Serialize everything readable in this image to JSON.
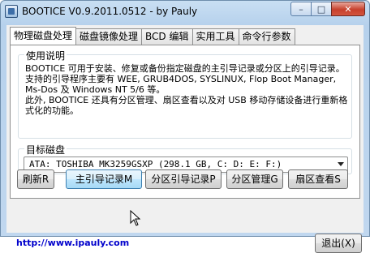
{
  "window": {
    "title": "BOOTICE V0.9.2011.0512 - by Pauly",
    "minimize_glyph": "–",
    "maximize_glyph": "□",
    "close_glyph": "✕"
  },
  "tabs": [
    {
      "label": "物理磁盘处理",
      "active": true
    },
    {
      "label": "磁盘镜像处理",
      "active": false
    },
    {
      "label": "BCD 编辑",
      "active": false
    },
    {
      "label": "实用工具",
      "active": false
    },
    {
      "label": "命令行参数",
      "active": false
    }
  ],
  "usage": {
    "label": "使用说明",
    "text": "BOOTICE 可用于安装、修复或备份指定磁盘的主引导记录或分区上的引导记录。支持的引导程序主要有 WEE, GRUB4DOS, SYSLINUX, Flop Boot Manager, Ms-Dos 及 Windows NT 5/6 等。\n此外, BOOTICE 还具有分区管理、扇区查看以及对 USB 移动存储设备进行重新格式化的功能。"
  },
  "target": {
    "label": "目标磁盘",
    "selected_disk": "ATA: TOSHIBA MK3259GSXP (298.1 GB, C: D: E: F:)"
  },
  "buttons": {
    "refresh": "刷新R",
    "mbr": "主引导记录M",
    "pbr": "分区引导记录P",
    "parts": "分区管理G",
    "sector": "扇区查看S",
    "exit": "退出(X)"
  },
  "footer": {
    "link": "http://www.ipauly.com"
  },
  "colors": {
    "link": "#0000cc",
    "close_button": "#c7402c",
    "hover_button": "#bee6fd"
  }
}
